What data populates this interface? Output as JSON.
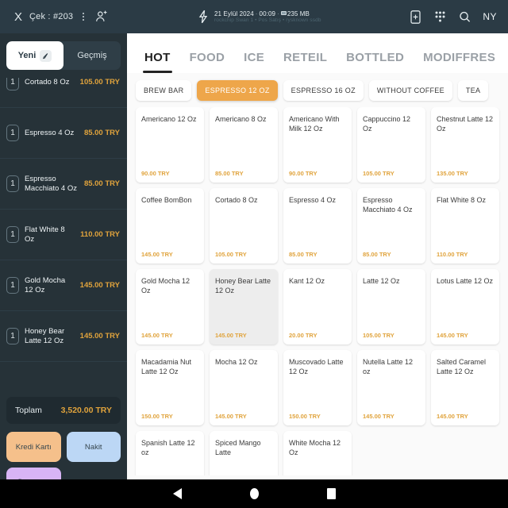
{
  "topbar": {
    "close_label": "X",
    "check_label": "Çek : #203",
    "menu_icon": "vertical-dots-icon",
    "add_person_icon": "add-person-icon",
    "bolt_icon": "lightning-bolt-icon",
    "date": "21 Eylül 2024",
    "time": "00:09",
    "memory": "235 MB",
    "subtitle": "rockchip Swan 1 • Pos Satış • rysknown ssdb",
    "icons": [
      "card-add-icon",
      "keypad-icon",
      "search-icon"
    ],
    "user": "NY"
  },
  "sidebar": {
    "tabs": [
      {
        "label": "Yeni",
        "active": true
      },
      {
        "label": "Geçmiş",
        "active": false
      }
    ],
    "cart_items": [
      {
        "qty": "1",
        "name": "Cortado 8 Oz",
        "price": "105.00 TRY"
      },
      {
        "qty": "1",
        "name": "Espresso 4 Oz",
        "price": "85.00 TRY"
      },
      {
        "qty": "1",
        "name": "Espresso Macchiato 4 Oz",
        "price": "85.00 TRY"
      },
      {
        "qty": "1",
        "name": "Flat White 8 Oz",
        "price": "110.00 TRY"
      },
      {
        "qty": "1",
        "name": "Gold Mocha 12 Oz",
        "price": "145.00 TRY"
      },
      {
        "qty": "1",
        "name": "Honey Bear Latte 12 Oz",
        "price": "145.00 TRY"
      }
    ],
    "total_label": "Toplam",
    "total_value": "3,520.00 TRY",
    "buttons": {
      "credit_card": "Kredi Kartı",
      "cash": "Nakit",
      "take_payment": "Ödeme Al"
    }
  },
  "main": {
    "tabs": [
      {
        "label": "HOT",
        "active": true
      },
      {
        "label": "FOOD",
        "active": false
      },
      {
        "label": "ICE",
        "active": false
      },
      {
        "label": "RETEIL",
        "active": false
      },
      {
        "label": "BOTTLED",
        "active": false
      },
      {
        "label": "MODIFFRES",
        "active": false
      }
    ],
    "chips": [
      {
        "label": "BREW BAR",
        "active": false
      },
      {
        "label": "ESPRESSO 12 OZ",
        "active": true
      },
      {
        "label": "ESPRESSO 16 OZ",
        "active": false
      },
      {
        "label": "WITHOUT COFFEE",
        "active": false
      },
      {
        "label": "TEA",
        "active": false
      }
    ],
    "products": [
      {
        "name": "Americano 12 Oz",
        "price": "90.00 TRY",
        "pressed": false
      },
      {
        "name": "Americano 8 Oz",
        "price": "85.00 TRY",
        "pressed": false
      },
      {
        "name": "Americano With Milk 12 Oz",
        "price": "90.00 TRY",
        "pressed": false
      },
      {
        "name": "Cappuccino 12 Oz",
        "price": "105.00 TRY",
        "pressed": false
      },
      {
        "name": "Chestnut Latte 12 Oz",
        "price": "135.00 TRY",
        "pressed": false
      },
      {
        "name": "Coffee BomBon",
        "price": "145.00 TRY",
        "pressed": false
      },
      {
        "name": "Cortado 8 Oz",
        "price": "105.00 TRY",
        "pressed": false
      },
      {
        "name": "Espresso 4 Oz",
        "price": "85.00 TRY",
        "pressed": false
      },
      {
        "name": "Espresso Macchiato 4 Oz",
        "price": "85.00 TRY",
        "pressed": false
      },
      {
        "name": "Flat White 8 Oz",
        "price": "110.00 TRY",
        "pressed": false
      },
      {
        "name": "Gold Mocha 12 Oz",
        "price": "145.00 TRY",
        "pressed": false
      },
      {
        "name": "Honey Bear Latte 12 Oz",
        "price": "145.00 TRY",
        "pressed": true
      },
      {
        "name": "Kant 12 Oz",
        "price": "20.00 TRY",
        "pressed": false
      },
      {
        "name": "Latte 12 Oz",
        "price": "105.00 TRY",
        "pressed": false
      },
      {
        "name": "Lotus Latte 12 Oz",
        "price": "145.00 TRY",
        "pressed": false
      },
      {
        "name": "Macadamia Nut Latte 12 Oz",
        "price": "150.00 TRY",
        "pressed": false
      },
      {
        "name": "Mocha 12 Oz",
        "price": "145.00 TRY",
        "pressed": false
      },
      {
        "name": "Muscovado Latte 12 Oz",
        "price": "150.00 TRY",
        "pressed": false
      },
      {
        "name": "Nutella Latte 12 oz",
        "price": "145.00 TRY",
        "pressed": false
      },
      {
        "name": "Salted Caramel Latte 12 Oz",
        "price": "145.00 TRY",
        "pressed": false
      },
      {
        "name": "Spanish Latte 12 oz",
        "price": "",
        "pressed": false
      },
      {
        "name": "Spiced Mango Latte",
        "price": "",
        "pressed": false
      },
      {
        "name": "White Mocha 12 Oz",
        "price": "",
        "pressed": false
      }
    ]
  },
  "navbar": {
    "back_icon": "back-triangle-icon",
    "home_icon": "home-circle-icon",
    "recents_icon": "recents-square-icon"
  },
  "colors": {
    "sidebar_bg": "#263238",
    "topbar_bg": "#2b3b45",
    "accent_orange": "#eea64a",
    "price_amber": "#e0a33c",
    "credit_card": "#f5c08b",
    "cash": "#bcd7f5",
    "take_payment": "#d8b4f5"
  }
}
